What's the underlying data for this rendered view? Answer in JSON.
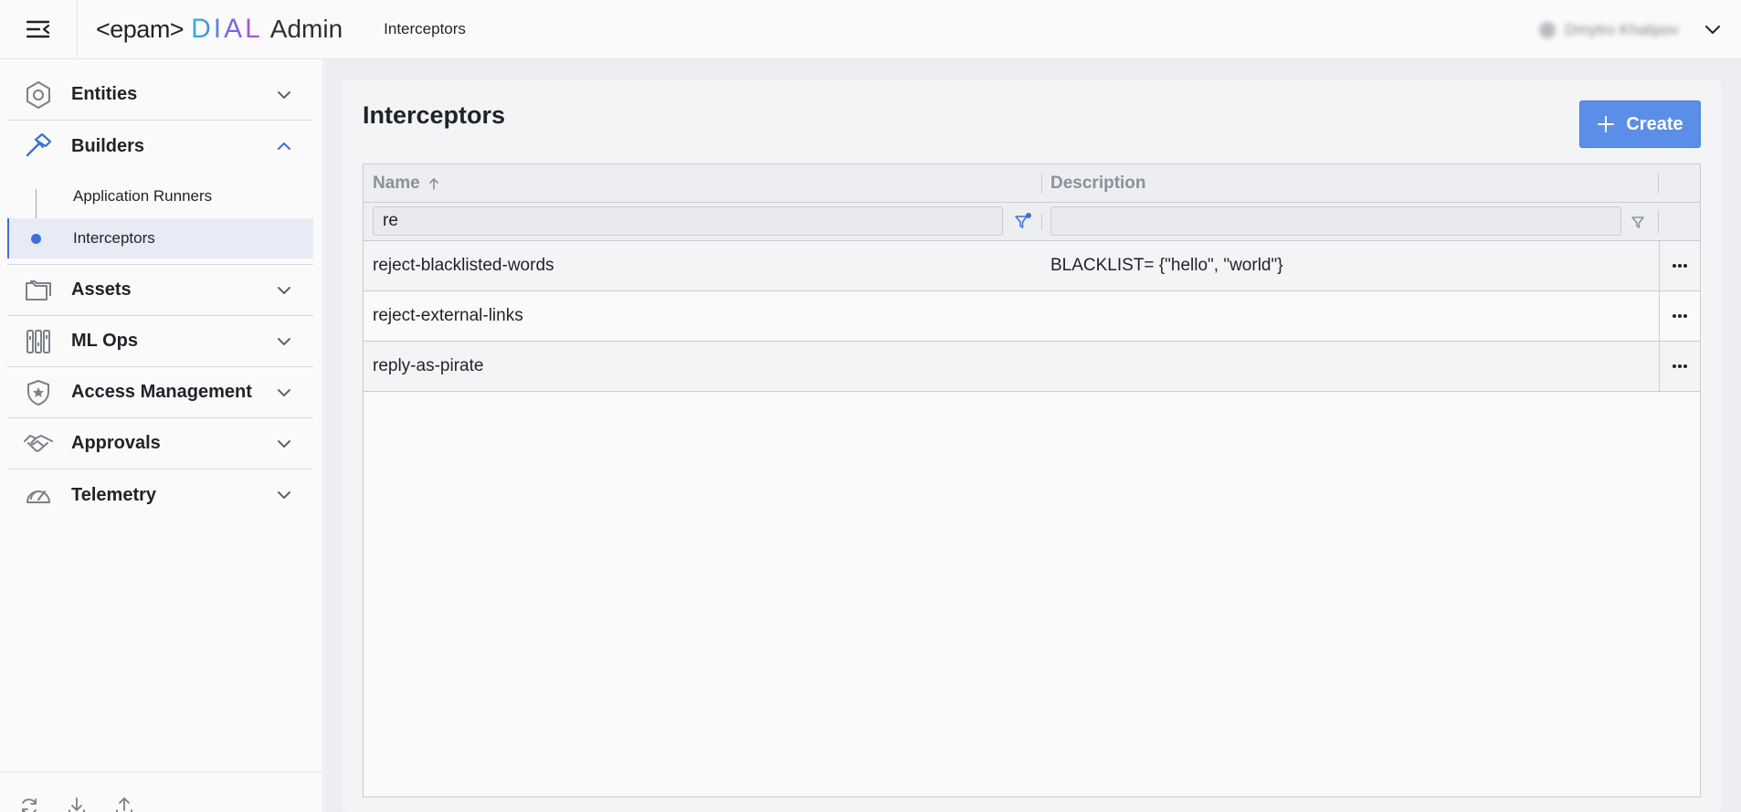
{
  "header": {
    "logo": {
      "epam": "<epam>",
      "dial": "DIAL",
      "admin": "Admin"
    },
    "breadcrumb": "Interceptors",
    "user_name": "Dmytro Khalipov"
  },
  "sidebar": {
    "sections": [
      {
        "key": "entities",
        "label": "Entities",
        "icon": "hexagon-icon",
        "expanded": false
      },
      {
        "key": "builders",
        "label": "Builders",
        "icon": "hammer-icon",
        "expanded": true,
        "items": [
          {
            "label": "Application Runners",
            "active": false
          },
          {
            "label": "Interceptors",
            "active": true
          }
        ]
      },
      {
        "key": "assets",
        "label": "Assets",
        "icon": "folder-icon",
        "expanded": false
      },
      {
        "key": "ml_ops",
        "label": "ML Ops",
        "icon": "ml-ops-icon",
        "expanded": false
      },
      {
        "key": "access",
        "label": "Access Management",
        "icon": "shield-star-icon",
        "expanded": false
      },
      {
        "key": "approvals",
        "label": "Approvals",
        "icon": "handshake-icon",
        "expanded": false
      },
      {
        "key": "telemetry",
        "label": "Telemetry",
        "icon": "gauge-icon",
        "expanded": false
      }
    ],
    "footer_icons": [
      "refresh-icon",
      "download-icon",
      "upload-icon"
    ]
  },
  "main": {
    "title": "Interceptors",
    "create_label": "Create",
    "table": {
      "columns": [
        {
          "label": "Name",
          "sort": "asc"
        },
        {
          "label": "Description"
        }
      ],
      "filters": {
        "name": "re",
        "description": ""
      },
      "rows": [
        {
          "name": "reject-blacklisted-words",
          "description": "BLACKLIST= {\"hello\", \"world\"}"
        },
        {
          "name": "reject-external-links",
          "description": ""
        },
        {
          "name": "reply-as-pirate",
          "description": ""
        }
      ]
    }
  },
  "colors": {
    "accent": "#5b8ee6",
    "active_bg": "#e6ebf5",
    "active_marker": "#3d6fd8"
  }
}
